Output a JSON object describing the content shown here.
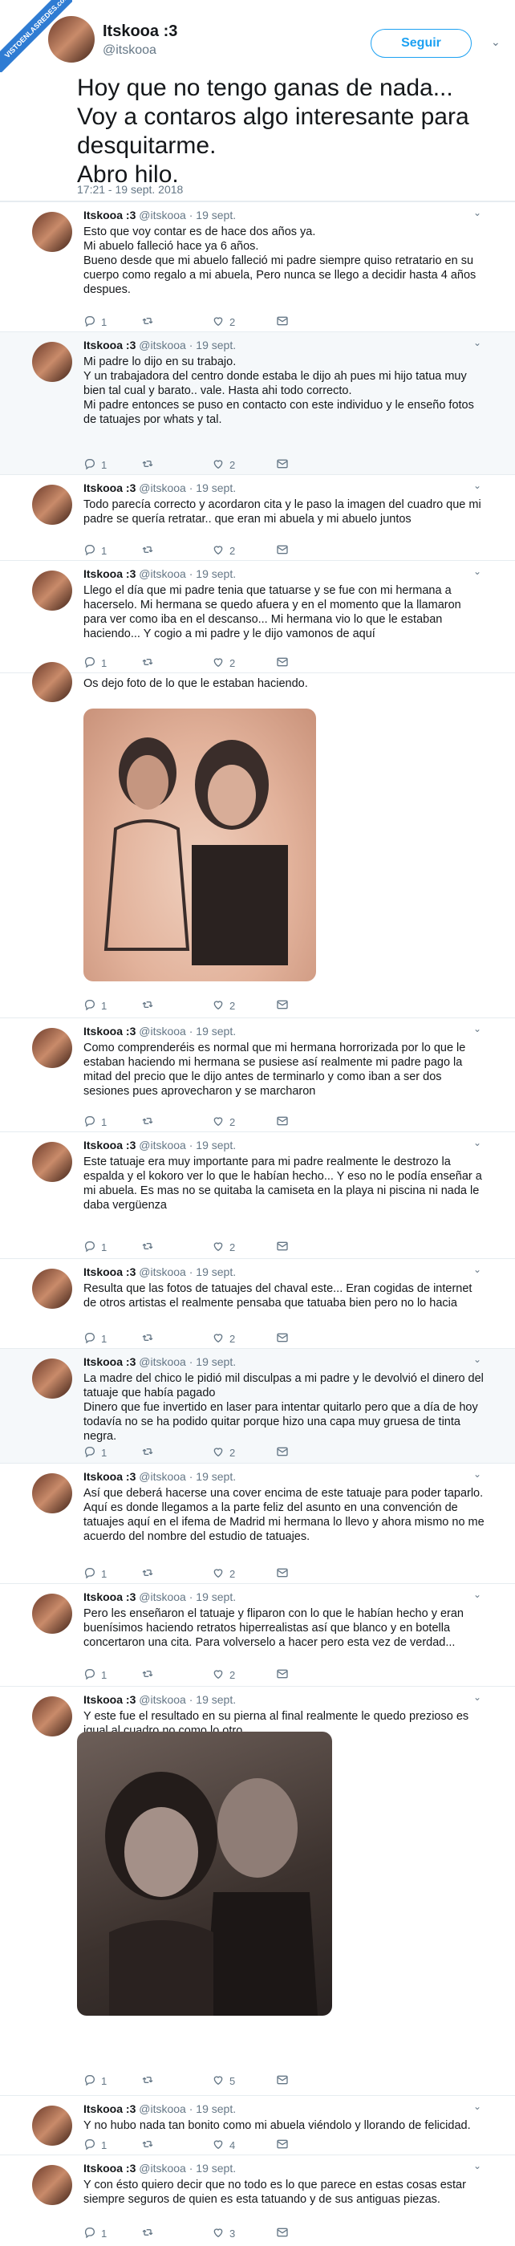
{
  "watermark": {
    "text": "VISTOENLASREDES.com"
  },
  "header": {
    "name": "Itskooa :3",
    "handle": "@itskooa",
    "follow_label": "Seguir",
    "text": "Hoy  que  no tengo ganas de nada...\nVoy a  contaros   algo interesante para desquitarme.\n Abro hilo.",
    "time": "17:21 - 19 sept. 2018"
  },
  "icons": {
    "reply": "reply-icon",
    "retweet": "retweet-icon",
    "like": "heart-icon",
    "message": "message-icon",
    "chevron": "chevron-down-icon"
  },
  "tweets": [
    {
      "name": "Itskooa :3",
      "handle": "@itskooa",
      "date": "19 sept.",
      "text": "Esto que voy   contar es de hace dos años ya.\nMi abuelo falleció  hace ya 6  años.\nBueno desde que mi abuelo falleció  mi padre  siempre  quiso retratario en su cuerpo como regalo a mi abuela, Pero  nunca  se llego a decidir  hasta  4  años despues.",
      "replies": "1",
      "retweets": "",
      "likes": "2"
    },
    {
      "name": "Itskooa :3",
      "handle": "@itskooa",
      "date": "19 sept.",
      "text": "Mi padre  lo dijo en su trabajo.\n Y  un trabajadora del centro donde estaba  le dijo ah pues mi hijo tatua muy bien tal cual  y barato..  vale. Hasta ahi todo  correcto.\nMi padre entonces se puso en contacto con este individuo y le enseño fotos de tatuajes por whats y tal.",
      "replies": "1",
      "retweets": "",
      "likes": "2"
    },
    {
      "name": "Itskooa :3",
      "handle": "@itskooa",
      "date": "19 sept.",
      "text": "Todo parecía correcto  y acordaron  cita  y le paso la imagen del cuadro que mi padre se quería retratar.. que eran mi abuela y mi abuelo juntos",
      "replies": "1",
      "retweets": "",
      "likes": "2"
    },
    {
      "name": "Itskooa :3",
      "handle": "@itskooa",
      "date": "19 sept.",
      "text": "Llego el día que mi padre tenia que tatuarse  y se fue con mi hermana  a hacerselo. Mi hermana  se quedo  afuera   y en el momento que la llamaron para ver como iba en el descanso... Mi hermana vio lo que le estaban haciendo... Y cogio a  mi padre y le dijo vamonos de aquí",
      "replies": "1",
      "retweets": "",
      "likes": "2"
    },
    {
      "name": "",
      "handle": "",
      "date": "",
      "text": "Os dejo foto de lo que le estaban haciendo.",
      "replies": "1",
      "retweets": "",
      "likes": "2"
    },
    {
      "name": "Itskooa :3",
      "handle": "@itskooa",
      "date": "19 sept.",
      "text": "Como comprenderéis   es normal que mi hermana horrorizada  por lo que le estaban haciendo mi hermana se pusiese  así  realmente mi padre pago la mitad del precio que le dijo antes  de terminarlo y como iban a  ser dos sesiones pues aprovecharon y se marcharon",
      "replies": "1",
      "retweets": "",
      "likes": "2"
    },
    {
      "name": "Itskooa :3",
      "handle": "@itskooa",
      "date": "19 sept.",
      "text": "Este  tatuaje  era  muy importante  para mi padre  realmente  le destrozo la espalda y el kokoro  ver lo que le habían  hecho...  Y eso no le podía enseñar a mi abuela. Es mas no se quitaba la camiseta en la playa ni piscina ni nada le daba vergüenza",
      "replies": "1",
      "retweets": "",
      "likes": "2"
    },
    {
      "name": "Itskooa :3",
      "handle": "@itskooa",
      "date": "19 sept.",
      "text": "Resulta  que las fotos de tatuajes del  chaval  este...   Eran cogidas  de internet de otros  artistas el realmente   pensaba que  tatuaba bien pero no lo hacia",
      "replies": "1",
      "retweets": "",
      "likes": "2"
    },
    {
      "name": "Itskooa :3",
      "handle": "@itskooa",
      "date": "19 sept.",
      "text": "La madre del chico  le pidió mil disculpas a  mi padre y le devolvió el dinero del tatuaje que había  pagado\nDinero que fue invertido   en laser  para intentar quitarlo pero que  a  día de hoy todavía no se ha podido quitar porque hizo una capa muy gruesa de tinta negra.",
      "replies": "1",
      "retweets": "",
      "likes": "2"
    },
    {
      "name": "Itskooa :3",
      "handle": "@itskooa",
      "date": "19 sept.",
      "text": "Así que  deberá  hacerse una cover encima de este tatuaje para poder taparlo.\nAquí  es donde llegamos a  la parte  feliz del asunto en una convención de tatuajes  aquí en el ifema de Madrid mi hermana lo llevo   y  ahora mismo no me acuerdo del nombre del estudio de tatuajes.",
      "replies": "1",
      "retweets": "",
      "likes": "2"
    },
    {
      "name": "Itskooa :3",
      "handle": "@itskooa",
      "date": "19 sept.",
      "text": "Pero les enseñaron  el tatuaje  y fliparon  con lo que le habían hecho y   eran buenísimos haciendo retratos hiperrealistas  así que blanco y en botella concertaron una cita. Para volverselo a hacer pero esta vez de verdad...",
      "replies": "1",
      "retweets": "",
      "likes": "2"
    },
    {
      "name": "Itskooa :3",
      "handle": "@itskooa",
      "date": "19 sept.",
      "text": "Y este  fue  el resultado en su pierna al final realmente  le quedo prezioso   es igual al cuadro no como lo otro...",
      "replies": "1",
      "retweets": "",
      "likes": "5"
    },
    {
      "name": "Itskooa :3",
      "handle": "@itskooa",
      "date": "19 sept.",
      "text": "Y no hubo nada tan bonito como mi abuela viéndolo  y llorando de felicidad.",
      "replies": "1",
      "retweets": "",
      "likes": "4"
    },
    {
      "name": "Itskooa :3",
      "handle": "@itskooa",
      "date": "19 sept.",
      "text": "Y con ésto  quiero decir que no todo es lo que parece en estas cosas estar siempre seguros  de quien es esta tatuando y de sus antiguas piezas.",
      "replies": "1",
      "retweets": "",
      "likes": "3"
    }
  ]
}
